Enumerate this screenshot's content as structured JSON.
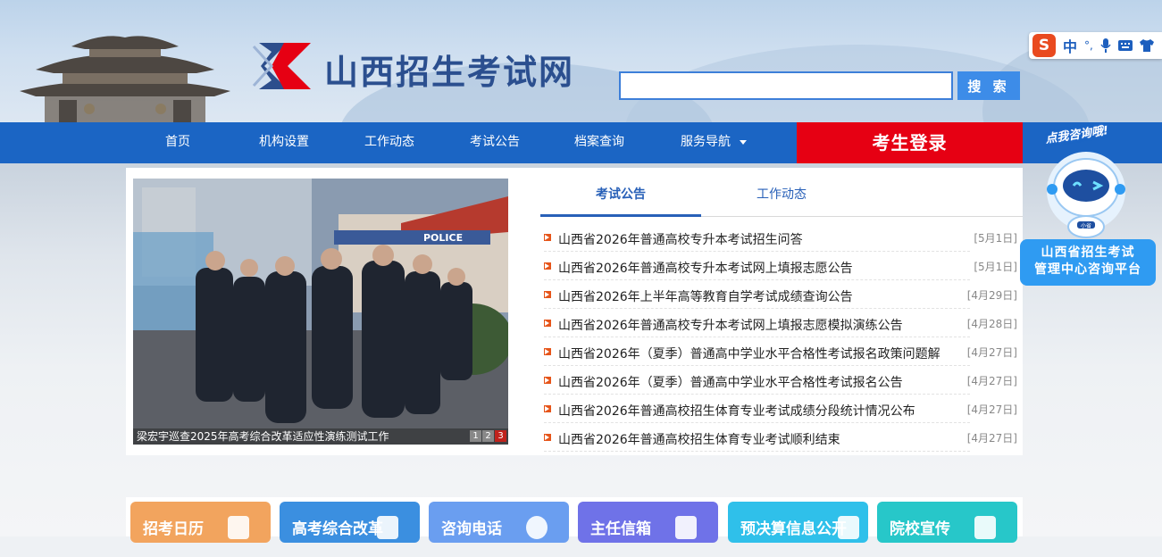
{
  "site": {
    "title": "山西招生考试网"
  },
  "search": {
    "placeholder": "",
    "button_label": "搜 索"
  },
  "ime": {
    "logo": "S",
    "lang": "中",
    "punct": "°,",
    "icons": [
      "microphone-icon",
      "keyboard-icon",
      "shirt-icon"
    ]
  },
  "nav": {
    "items": [
      "首页",
      "机构设置",
      "工作动态",
      "考试公告",
      "档案查询",
      "服务导航"
    ],
    "login": "考生登录"
  },
  "slider": {
    "caption": "梁宏宇巡查2025年高考综合改革适应性演练测试工作",
    "pages": [
      "1",
      "2",
      "3"
    ],
    "active_page": "3",
    "sign_text": "POLICE"
  },
  "tabs": {
    "items": [
      "考试公告",
      "工作动态"
    ],
    "active": "考试公告"
  },
  "news": [
    {
      "title": "山西省2026年普通高校专升本考试招生问答",
      "date": "[5月1日]"
    },
    {
      "title": "山西省2026年普通高校专升本考试网上填报志愿公告",
      "date": "[5月1日]"
    },
    {
      "title": "山西省2026年上半年高等教育自学考试成绩查询公告",
      "date": "[4月29日]"
    },
    {
      "title": "山西省2026年普通高校专升本考试网上填报志愿模拟演练公告",
      "date": "[4月28日]"
    },
    {
      "title": "山西省2026年（夏季）普通高中学业水平合格性考试报名政策问题解",
      "date": "[4月27日]"
    },
    {
      "title": "山西省2026年（夏季）普通高中学业水平合格性考试报名公告",
      "date": "[4月27日]"
    },
    {
      "title": "山西省2026年普通高校招生体育专业考试成绩分段统计情况公布",
      "date": "[4月27日]"
    },
    {
      "title": "山西省2026年普通高校招生体育专业考试顺利结束",
      "date": "[4月27日]"
    }
  ],
  "side": {
    "top_text": "点我咨询哦!",
    "robot_label": "小省",
    "line1": "山西省招生考试",
    "line2": "管理中心咨询平台"
  },
  "tiles": [
    {
      "label": "招考日历",
      "color": "#f2a45e"
    },
    {
      "label": "高考综合改革",
      "color": "#3b8fe0"
    },
    {
      "label": "咨询电话",
      "color": "#6a9ef0"
    },
    {
      "label": "主任信箱",
      "color": "#6f72e8"
    },
    {
      "label": "预决算信息公开",
      "color": "#2fc0ea"
    },
    {
      "label": "院校宣传",
      "color": "#27c7c9"
    }
  ],
  "colors": {
    "nav": "#1b65c4",
    "login": "#e60013",
    "accent": "#2860b8",
    "bullet": "#e6551a"
  }
}
